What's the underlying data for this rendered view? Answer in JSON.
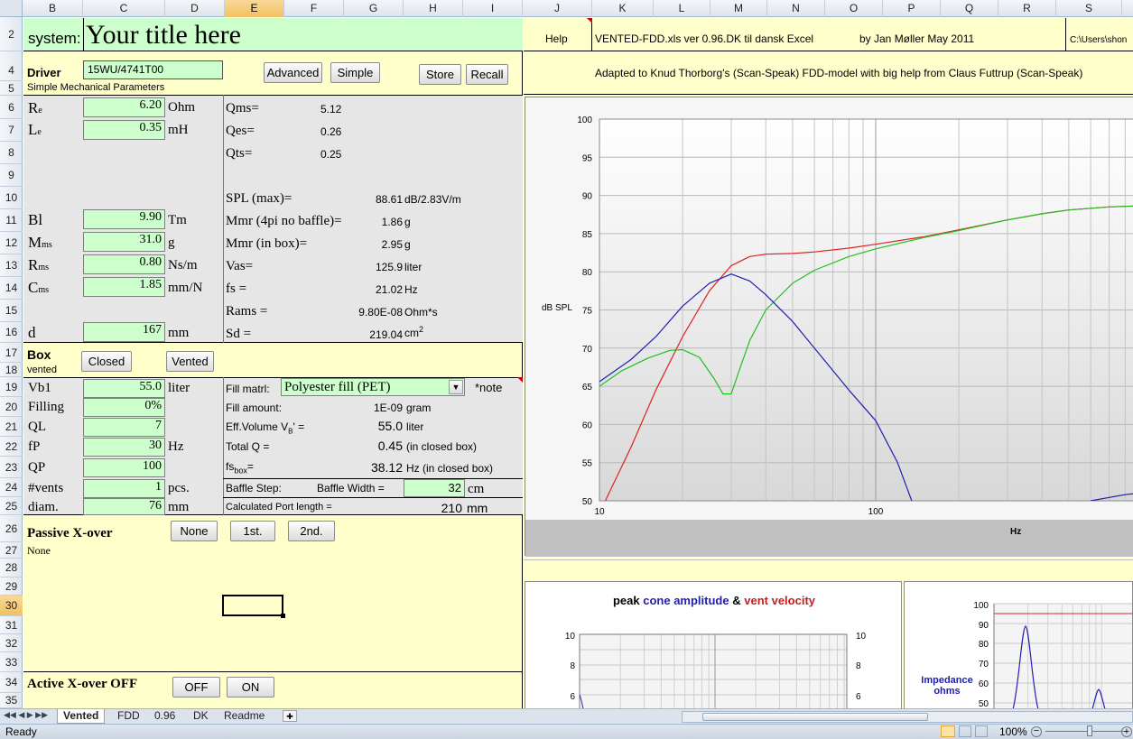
{
  "columns": [
    "B",
    "C",
    "D",
    "E",
    "F",
    "G",
    "H",
    "I",
    "J",
    "K",
    "L",
    "M",
    "N",
    "O",
    "P",
    "Q",
    "R",
    "S"
  ],
  "rows": [
    "2",
    "4",
    "5",
    "6",
    "7",
    "8",
    "9",
    "10",
    "11",
    "12",
    "13",
    "14",
    "15",
    "16",
    "17",
    "18",
    "19",
    "20",
    "21",
    "22",
    "23",
    "24",
    "25",
    "26",
    "27",
    "28",
    "29",
    "30",
    "31",
    "32",
    "33",
    "34",
    "35"
  ],
  "header": {
    "system_label": "system:",
    "title": "Your title here",
    "help": "Help",
    "version": "VENTED-FDD.xls  ver 0.96.DK  til dansk Excel",
    "author": "by  Jan Møller   May 2011",
    "path": "C:\\Users\\shon",
    "adapted": "Adapted to Knud Thorborg's (Scan-Speak)  FDD-model with big help from Claus Futtrup (Scan-Speak)"
  },
  "driver": {
    "label": "Driver",
    "model": "15WU/4741T00",
    "subtitle": "Simple Mechanical Parameters",
    "advanced": "Advanced",
    "simple": "Simple",
    "store": "Store",
    "recall": "Recall"
  },
  "params": {
    "re": {
      "name": "Re",
      "sub": "e",
      "base": "R",
      "value": "6.20",
      "unit": "Ohm"
    },
    "le": {
      "base": "L",
      "sub": "e",
      "value": "0.35",
      "unit": "mH"
    },
    "bl": {
      "name": "Bl",
      "value": "9.90",
      "unit": "Tm"
    },
    "mms": {
      "base": "M",
      "sub": "ms",
      "value": "31.0",
      "unit": "g"
    },
    "rms": {
      "base": "R",
      "sub": "ms",
      "value": "0.80",
      "unit": "Ns/m"
    },
    "cms": {
      "base": "C",
      "sub": "ms",
      "value": "1.85",
      "unit": "mm/N"
    },
    "d": {
      "name": "d",
      "value": "167",
      "unit": "mm"
    }
  },
  "computed": {
    "qms": {
      "label": "Qms=",
      "value": "5.12"
    },
    "qes": {
      "label": "Qes=",
      "value": "0.26"
    },
    "qts": {
      "label": "Qts=",
      "value": "0.25"
    },
    "spl": {
      "label": "SPL (max)=",
      "value": "88.61",
      "unit": "dB/2.83V/m"
    },
    "mmr4pi": {
      "label": "Mmr (4pi no baffle)=",
      "value": "1.86",
      "unit": "g"
    },
    "mmrbox": {
      "label": "Mmr (in box)=",
      "value": "2.95",
      "unit": "g"
    },
    "vas": {
      "label": "Vas=",
      "value": "125.9",
      "unit": "liter"
    },
    "fs": {
      "label": "fs =",
      "value": "21.02",
      "unit": "Hz"
    },
    "rams": {
      "label": "Rams =",
      "value": "9.80E-08",
      "unit": "Ohm*s"
    },
    "sd": {
      "label": "Sd =",
      "value": "219.04",
      "unit": "cm",
      "sup": "2"
    }
  },
  "box": {
    "label": "Box",
    "type": "vented",
    "closed": "Closed",
    "vented": "Vented",
    "vb1": {
      "label": "Vb1",
      "value": "55.0",
      "unit": "liter"
    },
    "filling": {
      "label": "Filling",
      "value": "0%"
    },
    "ql": {
      "label": "QL",
      "value": "7"
    },
    "fp": {
      "label": "fP",
      "value": "30",
      "unit": "Hz"
    },
    "qp": {
      "label": "QP",
      "value": "100"
    },
    "vents": {
      "label": "#vents",
      "value": "1",
      "unit": "pcs."
    },
    "diam": {
      "label": "diam.",
      "value": "76",
      "unit": "mm"
    },
    "fill_matrl_label": "Fill matrl:",
    "fill_matrl": "Polyester fill (PET)",
    "note": "*note",
    "fill_amount_label": "Fill amount:",
    "fill_amount": "1E-09",
    "fill_amount_unit": "gram",
    "eff_volume_label": "Eff.Volume V",
    "eff_volume_sub": "B",
    "eff_volume_tail": "' =",
    "eff_volume": "55.0",
    "eff_volume_unit": "liter",
    "total_q_label": "Total Q =",
    "total_q": "0.45",
    "total_q_note": "(in closed box)",
    "fs_box_label": "fs",
    "fs_box_sub": "box",
    "fs_box_tail": "=",
    "fs_box": "38.12",
    "fs_box_unit": "Hz  (in closed box)",
    "baffle_step": "Baffle Step:",
    "baffle_width_label": "Baffle Width  =",
    "baffle_width": "32",
    "baffle_width_unit": "cm",
    "port_length_label": "Calculated Port length =",
    "port_length": "210",
    "port_length_unit": "mm"
  },
  "xover": {
    "passive_label": "Passive X-over",
    "passive_value": "None",
    "none": "None",
    "first": "1st.",
    "second": "2nd.",
    "active_label": "Active X-over OFF",
    "off": "OFF",
    "on": "ON"
  },
  "chart_data": [
    {
      "type": "line",
      "title": "",
      "xlabel": "Hz",
      "ylabel": "dB SPL",
      "xscale": "log",
      "xlim": [
        10,
        1000
      ],
      "ylim": [
        50,
        100
      ],
      "yticks": [
        50,
        55,
        60,
        65,
        70,
        75,
        80,
        85,
        90,
        95,
        100
      ],
      "xticklabels": [
        "10",
        "100"
      ],
      "grid": true,
      "series": [
        {
          "color": "#e02020",
          "x": [
            10.5,
            13,
            16,
            20,
            25,
            30,
            35,
            40,
            50,
            60,
            80,
            100,
            150,
            200,
            300,
            400,
            500,
            700,
            1000
          ],
          "y": [
            50,
            57,
            64.5,
            71.5,
            77.5,
            80.8,
            82,
            82.3,
            82.4,
            82.6,
            83.1,
            83.6,
            84.6,
            85.5,
            86.8,
            87.6,
            88.1,
            88.5,
            88.7
          ]
        },
        {
          "color": "#20c020",
          "x": [
            10,
            12,
            15,
            18,
            20,
            23,
            26,
            28,
            30,
            32,
            35,
            40,
            50,
            60,
            80,
            100,
            150,
            200,
            300,
            400,
            500,
            700,
            1000
          ],
          "y": [
            65,
            67,
            68.7,
            69.7,
            69.8,
            68.8,
            66,
            64,
            64,
            67,
            71,
            75,
            78.5,
            80.2,
            82,
            83,
            84.5,
            85.4,
            86.8,
            87.6,
            88.1,
            88.5,
            88.7
          ]
        },
        {
          "color": "#2020b0",
          "x": [
            10,
            13,
            16,
            20,
            25,
            30,
            35,
            40,
            50,
            60,
            80,
            100,
            120,
            135
          ],
          "y": [
            65.6,
            68.5,
            71.5,
            75.5,
            78.5,
            79.7,
            78.8,
            77,
            73.5,
            70,
            64.5,
            60.5,
            55,
            50
          ]
        },
        {
          "color": "#2020b0",
          "x": [
            600,
            800,
            1000
          ],
          "y": [
            50,
            50.8,
            51.2
          ]
        }
      ]
    },
    {
      "type": "line",
      "title": "peak cone amplitude & vent velocity",
      "title_part1": "peak",
      "title_part2": "cone amplitude",
      "title_part3": "&",
      "title_part4": "vent velocity",
      "yticks_left": [
        "10",
        "8",
        "6"
      ],
      "yticks_right": [
        "10",
        "8",
        "6"
      ],
      "grid": true,
      "series": []
    },
    {
      "type": "line",
      "title": "",
      "ylabel": "Impedance ohms",
      "ylabel1": "Impedance",
      "ylabel2": "ohms",
      "yticks": [
        "100",
        "90",
        "80",
        "70",
        "60",
        "50"
      ],
      "grid": true,
      "series": [
        {
          "color": "#2020b0",
          "x": [
            0,
            1,
            2,
            3,
            4,
            5
          ],
          "y": [
            40,
            40,
            88,
            40,
            40,
            40
          ]
        },
        {
          "color": "#e02020",
          "x": [
            0,
            5
          ],
          "y": [
            95,
            95
          ]
        }
      ]
    }
  ],
  "tabs": [
    "Vented",
    "FDD",
    "0.96",
    "DK",
    "Readme"
  ],
  "active_tab": "Vented",
  "status": {
    "ready": "Ready",
    "zoom": "100%"
  }
}
